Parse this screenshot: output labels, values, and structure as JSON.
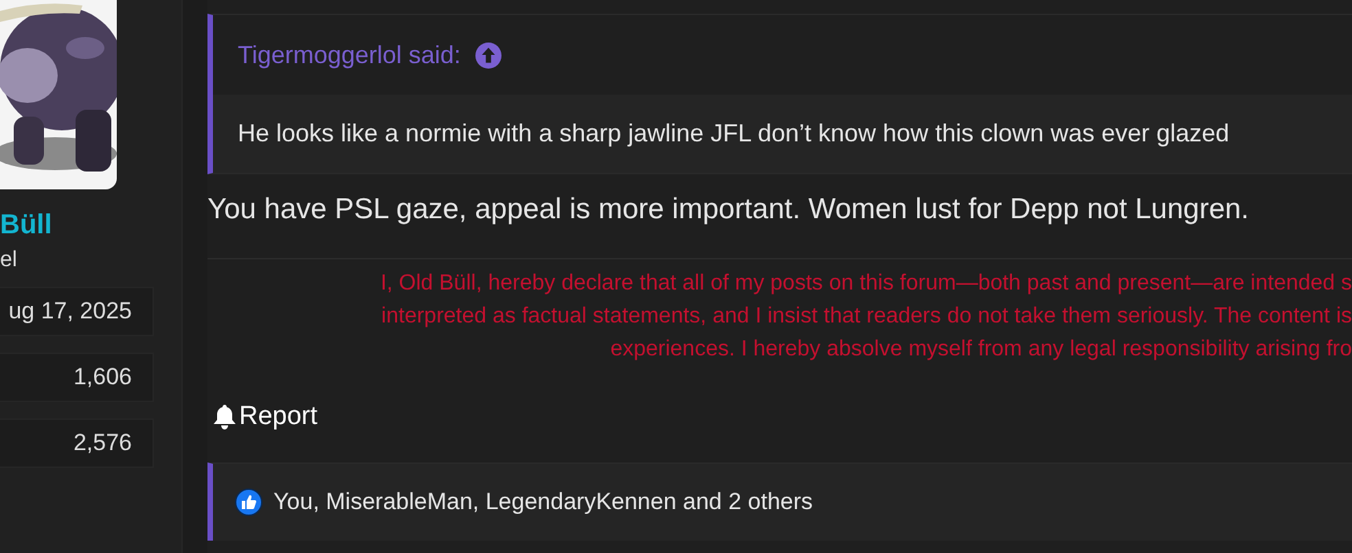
{
  "user": {
    "name": "Büll",
    "title": "el",
    "stats": [
      {
        "value": "ug 17, 2025"
      },
      {
        "value": "1,606"
      },
      {
        "value": "2,576"
      }
    ]
  },
  "post": {
    "quote": {
      "author": "Tigermoggerlol said:",
      "text": "He looks like a normie with a sharp jawline JFL don’t know how this clown was ever glazed"
    },
    "body": "You have PSL gaze, appeal is more important. Women lust for Depp not Lungren.",
    "signature": [
      "I, Old Büll, hereby declare that all of my posts on this forum—both past and present—are intended s",
      "interpreted as factual statements, and I insist that readers do not take them seriously. The content is",
      "experiences. I hereby absolve myself from any legal responsibility arising fro"
    ],
    "actions": [
      {
        "kind": "report",
        "label": "Report"
      }
    ],
    "reactions": "You, MiserableMan, LegendaryKennen and 2 others"
  }
}
